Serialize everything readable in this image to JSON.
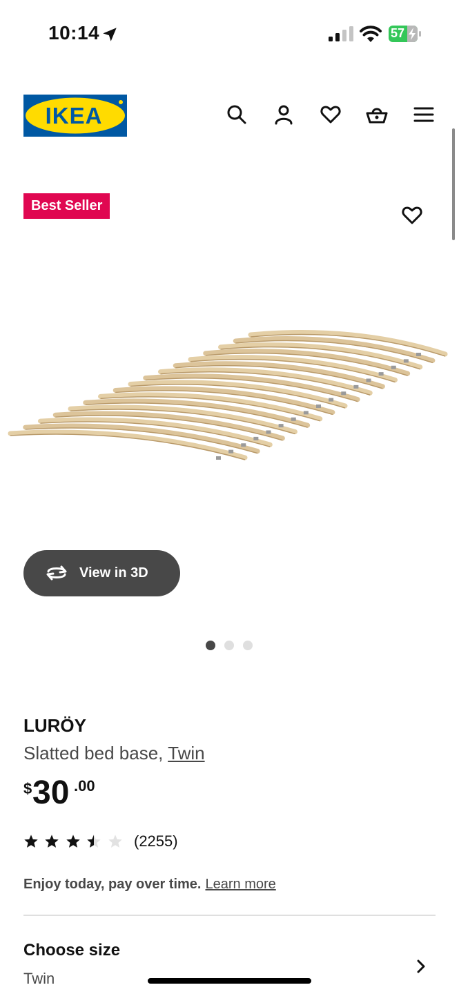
{
  "status_bar": {
    "time": "10:14",
    "battery": "57",
    "icons": [
      "location-arrow-icon",
      "cellular-signal-icon",
      "wifi-icon",
      "battery-charging-icon"
    ]
  },
  "header": {
    "logo_text": "IKEA",
    "icons": [
      "search-icon",
      "account-icon",
      "heart-icon",
      "shopping-basket-icon",
      "menu-icon"
    ]
  },
  "product": {
    "badge": "Best Seller",
    "view_3d_label": "View in 3D",
    "name": "LURÖY",
    "description": "Slatted bed base, ",
    "size_link": "Twin",
    "price": {
      "currency": "$",
      "integer": "30",
      "decimal": ".00"
    },
    "rating": {
      "value": 3.5,
      "max": 5,
      "review_count": "(2255)"
    },
    "carousel": {
      "total": 3,
      "active": 1
    }
  },
  "financing": {
    "text": "Enjoy today, pay over time.",
    "link": "Learn more"
  },
  "options": {
    "choose_size_title": "Choose size",
    "choose_size_value": "Twin"
  },
  "colors": {
    "brand_blue": "#0058a3",
    "brand_yellow": "#ffdb00",
    "badge_red": "#e00751",
    "button_dark": "#484848",
    "battery_green": "#34c759"
  }
}
